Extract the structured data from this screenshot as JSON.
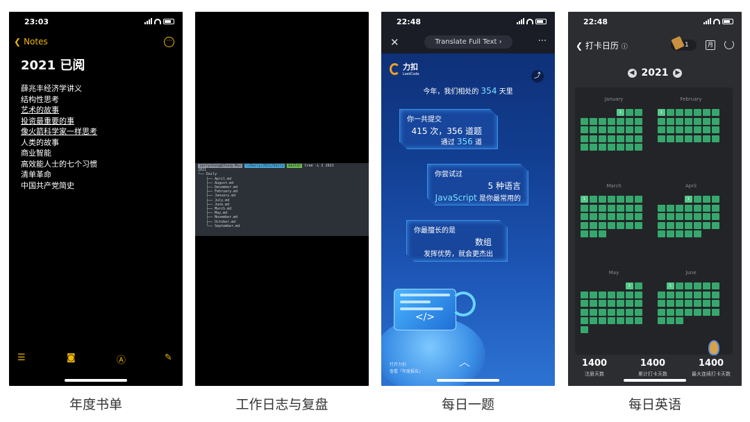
{
  "notes": {
    "time": "23:03",
    "back_label": "Notes",
    "title": "2021 已阅",
    "books": [
      "薛兆丰经济学讲义",
      "结构性思考",
      "艺术的故事",
      "投资最重要的事",
      "像火箭科学家一样思考",
      "人类的故事",
      "商业智能",
      "高效能人士的七个习惯",
      "清单革命",
      "中国共产党简史"
    ],
    "caption": "年度书单"
  },
  "terminal": {
    "prompt_user": "larrychong@Chung-Mac",
    "prompt_path": "~/Daily/2021/Daily",
    "prompt_branch": "master",
    "command": "tree -L 2 2021",
    "tree": [
      "2021",
      "└── Daily",
      "    ├── April.md",
      "    ├── August.md",
      "    ├── December.md",
      "    ├── February.md",
      "    ├── January.md",
      "    ├── July.md",
      "    ├── June.md",
      "    ├── March.md",
      "    ├── May.md",
      "    ├── November.md",
      "    ├── October.md",
      "    └── September.md"
    ],
    "caption": "工作日志与复盘"
  },
  "leetcode": {
    "time": "22:48",
    "translate_label": "Translate Full Text ›",
    "logo_cn": "力扣",
    "logo_en": "LeetCode",
    "intro_prefix": "今年，我们相处的",
    "intro_days": "354",
    "intro_suffix": "天里",
    "card1_title": "你一共提交",
    "card1_line1": "415 次，356 道题",
    "card1_line2_prefix": "通过",
    "card1_line2_num": "356",
    "card1_line2_suffix": "道",
    "card2_title": "你尝试过",
    "card2_line1": "5 种语言",
    "card2_line2_lang": "JavaScript",
    "card2_line2_suffix": "是你最常用的",
    "card3_title": "你最擅长的是",
    "card3_line1": "数组",
    "card3_line2": "发挥优势，就会更杰出",
    "footer_line1": "打开力扣",
    "footer_line2": "查看「年度报告」",
    "caption": "每日一题"
  },
  "english": {
    "time": "22:48",
    "title": "打卡日历",
    "badge_count": "1",
    "calendar_icon_label": "月",
    "year": "2021",
    "months": [
      {
        "name": "January",
        "lead": 4,
        "days": 31,
        "badge": "1"
      },
      {
        "name": "February",
        "lead": 0,
        "days": 28,
        "badge": "1"
      },
      {
        "name": "March",
        "lead": 0,
        "days": 31,
        "badge": "1"
      },
      {
        "name": "April",
        "lead": 3,
        "days": 30,
        "badge": "1"
      },
      {
        "name": "May",
        "lead": 5,
        "days": 31,
        "badge": "1"
      },
      {
        "name": "June",
        "lead": 1,
        "days": 30,
        "badge": "1"
      }
    ],
    "stats": [
      {
        "value": "1400",
        "label": "注册天数"
      },
      {
        "value": "1400",
        "label": "累计打卡天数"
      },
      {
        "value": "1400",
        "label": "最大连续打卡天数"
      }
    ],
    "caption": "每日英语"
  }
}
